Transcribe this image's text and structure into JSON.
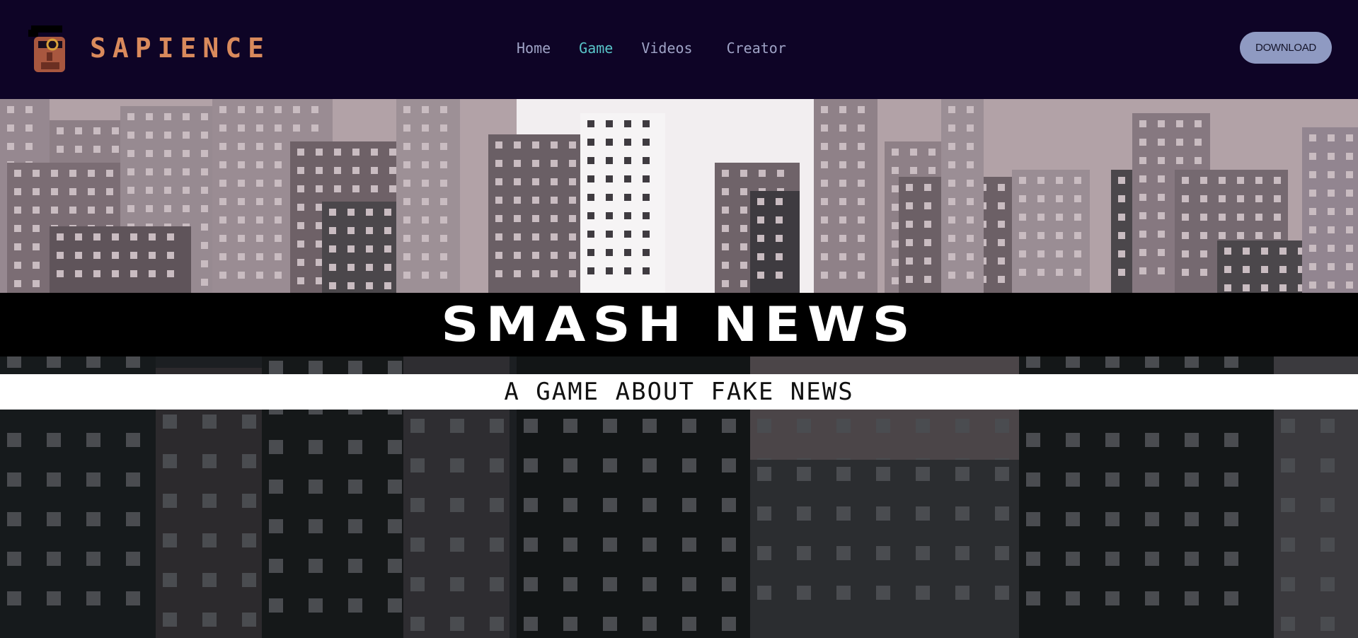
{
  "brand": {
    "name": "SAPIENCE"
  },
  "nav": {
    "links": [
      {
        "label": "Home",
        "active": false
      },
      {
        "label": "Game",
        "active": true
      },
      {
        "label": "Videos",
        "active": false
      },
      {
        "label": "Creator",
        "active": false
      }
    ],
    "download_label": "DOWNLOAD"
  },
  "hero": {
    "title": "SMASH NEWS",
    "subtitle": "A GAME ABOUT FAKE NEWS"
  },
  "colors": {
    "nav_bg": "#0e0426",
    "brand": "#d98a5c",
    "link": "#9fa3c6",
    "link_active": "#58c4c8",
    "button_bg": "#8f9ac2"
  }
}
